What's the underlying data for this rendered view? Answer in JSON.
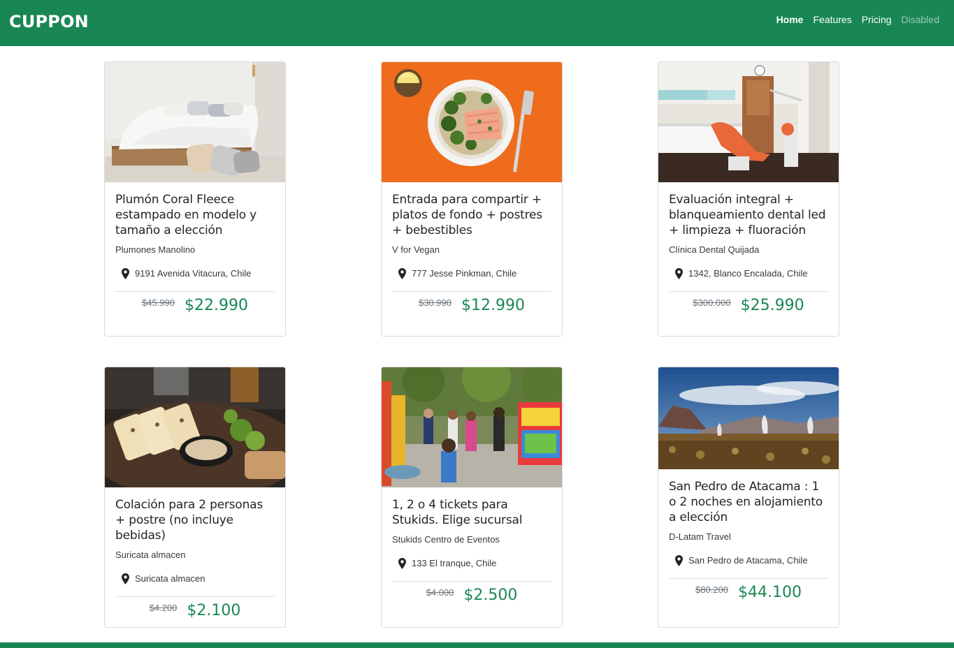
{
  "brand": "CUPPON",
  "nav": {
    "home": "Home",
    "features": "Features",
    "pricing": "Pricing",
    "disabled": "Disabled"
  },
  "colors": {
    "accent": "#198754"
  },
  "cards": [
    {
      "title": "Plumón Coral Fleece estampado en modelo y tamaño a elección",
      "company": "Plumones Manolino",
      "location": "9191 Avenida Vitacura, Chile",
      "old_price": "$45.990",
      "price": "$22.990",
      "image": "bedroom-bed"
    },
    {
      "title": "Entrada para compartir + platos de fondo + postres + bebestibles",
      "company": "V for Vegan",
      "location": "777 Jesse Pinkman, Chile",
      "old_price": "$30.990",
      "price": "$12.990",
      "image": "salmon-plate-orange"
    },
    {
      "title": "Evaluación integral + blanqueamiento dental led + limpieza + fluoración",
      "company": "Clínica Dental Quijada",
      "location": "1342, Blanco Encalada, Chile",
      "old_price": "$300.000",
      "price": "$25.990",
      "image": "dental-clinic"
    },
    {
      "title": "Colación para 2 personas + postre (no incluye bebidas)",
      "company": "Suricata almacen",
      "location": "Suricata almacen",
      "old_price": "$4.200",
      "price": "$2.100",
      "image": "grilled-food-plate"
    },
    {
      "title": "1, 2 o 4 tickets para Stukids. Elige sucursal",
      "company": "Stukids Centro de Eventos",
      "location": "133 El tranque, Chile",
      "old_price": "$4.000",
      "price": "$2.500",
      "image": "kids-fair"
    },
    {
      "title": "San Pedro de Atacama : 1 o 2 noches en alojamiento a elección",
      "company": "D-Latam Travel",
      "location": "San Pedro de Atacama, Chile",
      "old_price": "$80.200",
      "price": "$44.100",
      "image": "atacama-geysers"
    }
  ]
}
